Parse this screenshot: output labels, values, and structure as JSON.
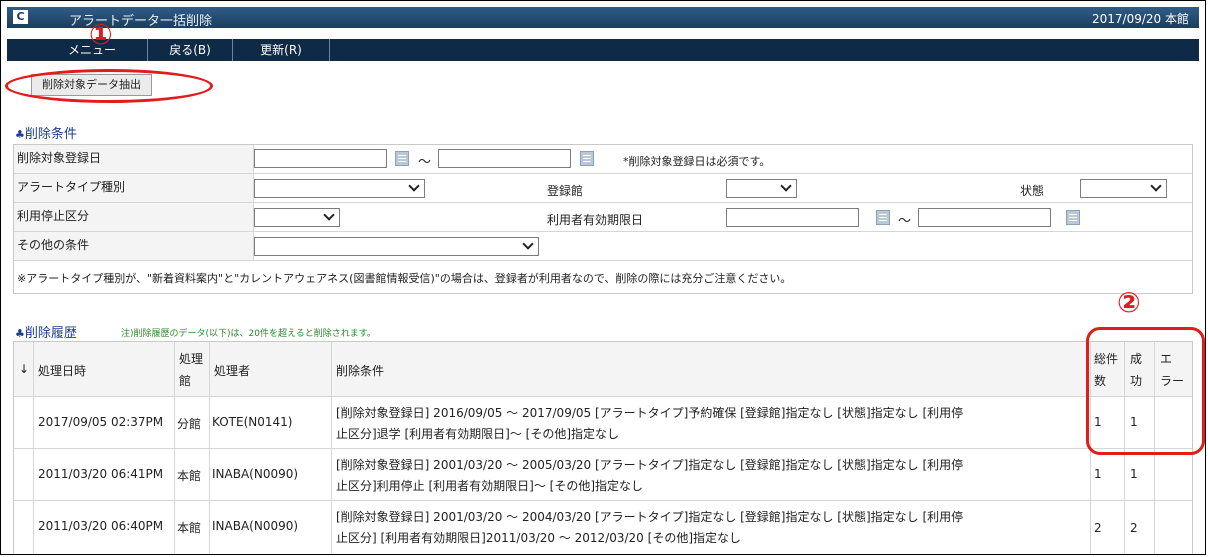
{
  "titlebar": {
    "logo": "C",
    "title": "アラートデータ一括削除",
    "date": "2017/09/20 本館"
  },
  "menu": {
    "items": [
      "メニュー",
      "戻る(B)",
      "更新(R)"
    ]
  },
  "toolbar": {
    "extract_label": "削除対象データ抽出"
  },
  "annotations": {
    "one": "①",
    "two": "②",
    "color": "#e21b1b"
  },
  "conditions": {
    "title": "削除条件",
    "reg_date_label": "削除対象登録日",
    "tilde": "～",
    "reg_date_note": "*削除対象登録日は必須です。",
    "alert_type_label": "アラートタイプ種別",
    "library_label": "登録館",
    "status_label": "状態",
    "suspend_label": "利用停止区分",
    "user_expiry_label": "利用者有効期限日",
    "other_label": "その他の条件",
    "notice": "※アラートタイプ種別が、\"新着資料案内\"と\"カレントアウェアネス(図書館情報受信)\"の場合は、登録者が利用者なので、削除の際には充分ご注意ください。"
  },
  "history": {
    "title": "削除履歴",
    "note": "注)削除履歴のデータ(以下)は、20件を超えると削除されます。",
    "headers": {
      "sort": "↓",
      "datetime": "処理日時",
      "lib": [
        "処理",
        "館"
      ],
      "user": "処理者",
      "cond": "削除条件",
      "total": [
        "総件",
        "数"
      ],
      "success": [
        "成",
        "功"
      ],
      "error": [
        "エ",
        "ラー"
      ]
    },
    "rows": [
      {
        "datetime": "2017/09/05  02:37PM",
        "lib": "分館",
        "user": "KOTE(N0141)",
        "cond1": "[削除対象登録日]  2016/09/05 ～ 2017/09/05 [アラートタイプ]予約確保   [登録館]指定なし [状態]指定なし    [利用停",
        "cond2": "止区分]退学  [利用者有効期限日]～    [その他]指定なし",
        "total": "1",
        "success": "1",
        "error": ""
      },
      {
        "datetime": "2011/03/20  06:41PM",
        "lib": "本館",
        "user": "INABA(N0090)",
        "cond1": "[削除対象登録日]  2001/03/20 ～ 2005/03/20 [アラートタイプ]指定なし   [登録館]指定なし [状態]指定なし    [利用停",
        "cond2": "止区分]利用停止  [利用者有効期限日]～    [その他]指定なし",
        "total": "1",
        "success": "1",
        "error": ""
      },
      {
        "datetime": "2011/03/20  06:40PM",
        "lib": "本館",
        "user": "INABA(N0090)",
        "cond1": "[削除対象登録日]  2001/03/20 ～ 2004/03/20 [アラートタイプ]指定なし   [登録館]指定なし [状態]指定なし    [利用停",
        "cond2": "止区分]   [利用者有効期限日]2011/03/20 ～ 2012/03/20  [その他]指定なし",
        "total": "2",
        "success": "2",
        "error": ""
      }
    ]
  }
}
